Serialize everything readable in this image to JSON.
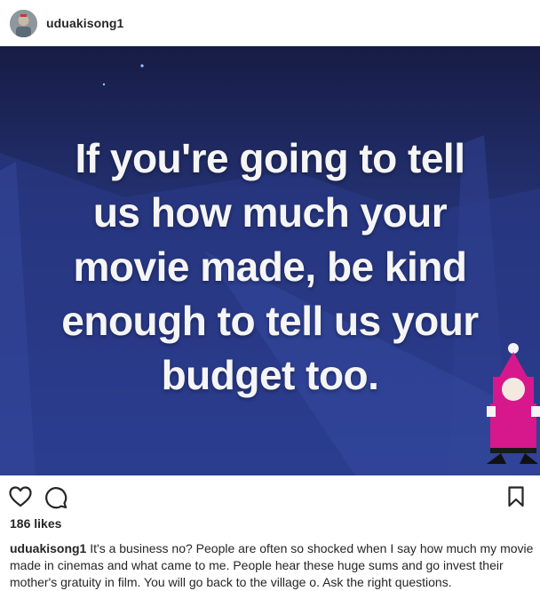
{
  "post": {
    "username": "uduakisong1",
    "quote_lines": [
      "If you're going to tell",
      "us how much your",
      "movie made, be kind",
      "enough to tell us your",
      "budget too."
    ],
    "likes": "186 likes",
    "caption_user": "uduakisong1",
    "caption_text": "It's a business no? People are often so shocked when I say how much my movie made in cinemas and what came to me. People hear these huge sums and go invest their mother's gratuity in film. You will go back to the village o. Ask the right questions."
  },
  "icons": {
    "like": "heart-icon",
    "comment": "comment-icon",
    "save": "bookmark-icon"
  },
  "colors": {
    "image_bg_top": "#1a2150",
    "image_bg_bottom": "#2c3f96",
    "moon": "#8eb4e8",
    "santa_pink": "#d6188c"
  }
}
